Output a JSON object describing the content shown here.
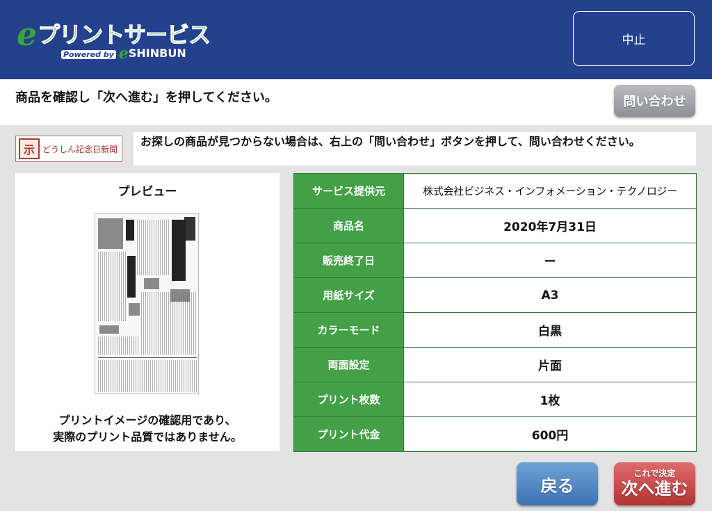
{
  "header": {
    "logo_e": "e",
    "logo_text": "プリントサービス",
    "logo_powered": "Powered by",
    "logo_sub_e": "e",
    "logo_sub_text": "SHINBUN",
    "stop_label": "中止"
  },
  "instruction": "商品を確認し「次へ進む」を押してください。",
  "inquiry_label": "問い合わせ",
  "brand": {
    "mark": "示",
    "name": "どうしん記念日新聞"
  },
  "notice": "お探しの商品が見つからない場合は、右上の「問い合わせ」ボタンを押して、問い合わせください。",
  "preview": {
    "title": "プレビュー",
    "note_line1": "プリントイメージの確認用であり、",
    "note_line2": "実際のプリント品質ではありません。"
  },
  "details": [
    {
      "label": "サービス提供元",
      "value": "株式会社ビジネス・インフォメーション・テクノロジー"
    },
    {
      "label": "商品名",
      "value": "2020年7月31日"
    },
    {
      "label": "販売終了日",
      "value": "ー"
    },
    {
      "label": "用紙サイズ",
      "value": "A3"
    },
    {
      "label": "カラーモード",
      "value": "白黒"
    },
    {
      "label": "両面設定",
      "value": "片面"
    },
    {
      "label": "プリント枚数",
      "value": "1枚"
    },
    {
      "label": "プリント代金",
      "value": "600円"
    }
  ],
  "buttons": {
    "back": "戻る",
    "next_sub": "これで決定",
    "next_main": "次へ進む"
  },
  "colors": {
    "header_bg": "#24418e",
    "table_label_bg": "#44a047",
    "back_btn": "#3b73b4",
    "next_btn": "#b23434"
  }
}
